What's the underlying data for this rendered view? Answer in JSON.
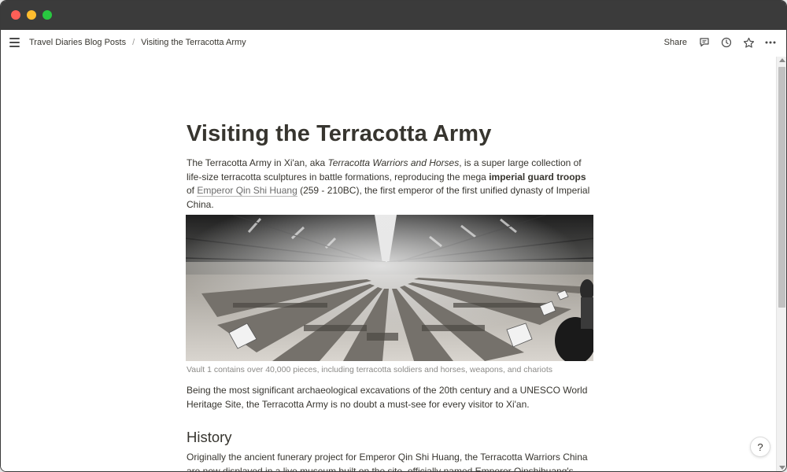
{
  "breadcrumb": {
    "items": [
      "Travel Diaries Blog Posts",
      "Visiting the Terracotta Army"
    ],
    "separator": "/"
  },
  "toolbar": {
    "share_label": "Share",
    "icons": [
      "comment-icon",
      "history-icon",
      "star-icon",
      "more-icon"
    ]
  },
  "article": {
    "title": "Visiting the Terracotta Army",
    "intro": {
      "part1": "The Terracotta Army in Xi'an, aka ",
      "italic": "Terracotta Warriors and Horses",
      "part2": ", is a super large collection of life-size terracotta sculptures in battle formations, reproducing the mega ",
      "bold": "imperial guard troops",
      "part3": " of ",
      "link": "Emperor Qin Shi Huang",
      "part4": " (259 - 210BC), the first emperor of the first unified dynasty of Imperial China."
    },
    "image_caption": "Vault 1 contains over 40,000 pieces, including terracotta soldiers and horses, weapons, and chariots",
    "paragraph2": "Being the most significant archaeological excavations of the 20th century and a UNESCO World Heritage Site, the Terracotta Army is no doubt a must-see for every visitor to Xi'an.",
    "section_heading": "History",
    "paragraph3": "Originally the ancient funerary project for Emperor Qin Shi Huang, the Terracotta Warriors China are now displayed in a live museum built on the site, officially named Emperor Qinshihuang's"
  },
  "help_label": "?",
  "colors": {
    "titlebar": "#3b3b3b",
    "text": "#37352f",
    "muted": "#8b8a87"
  }
}
